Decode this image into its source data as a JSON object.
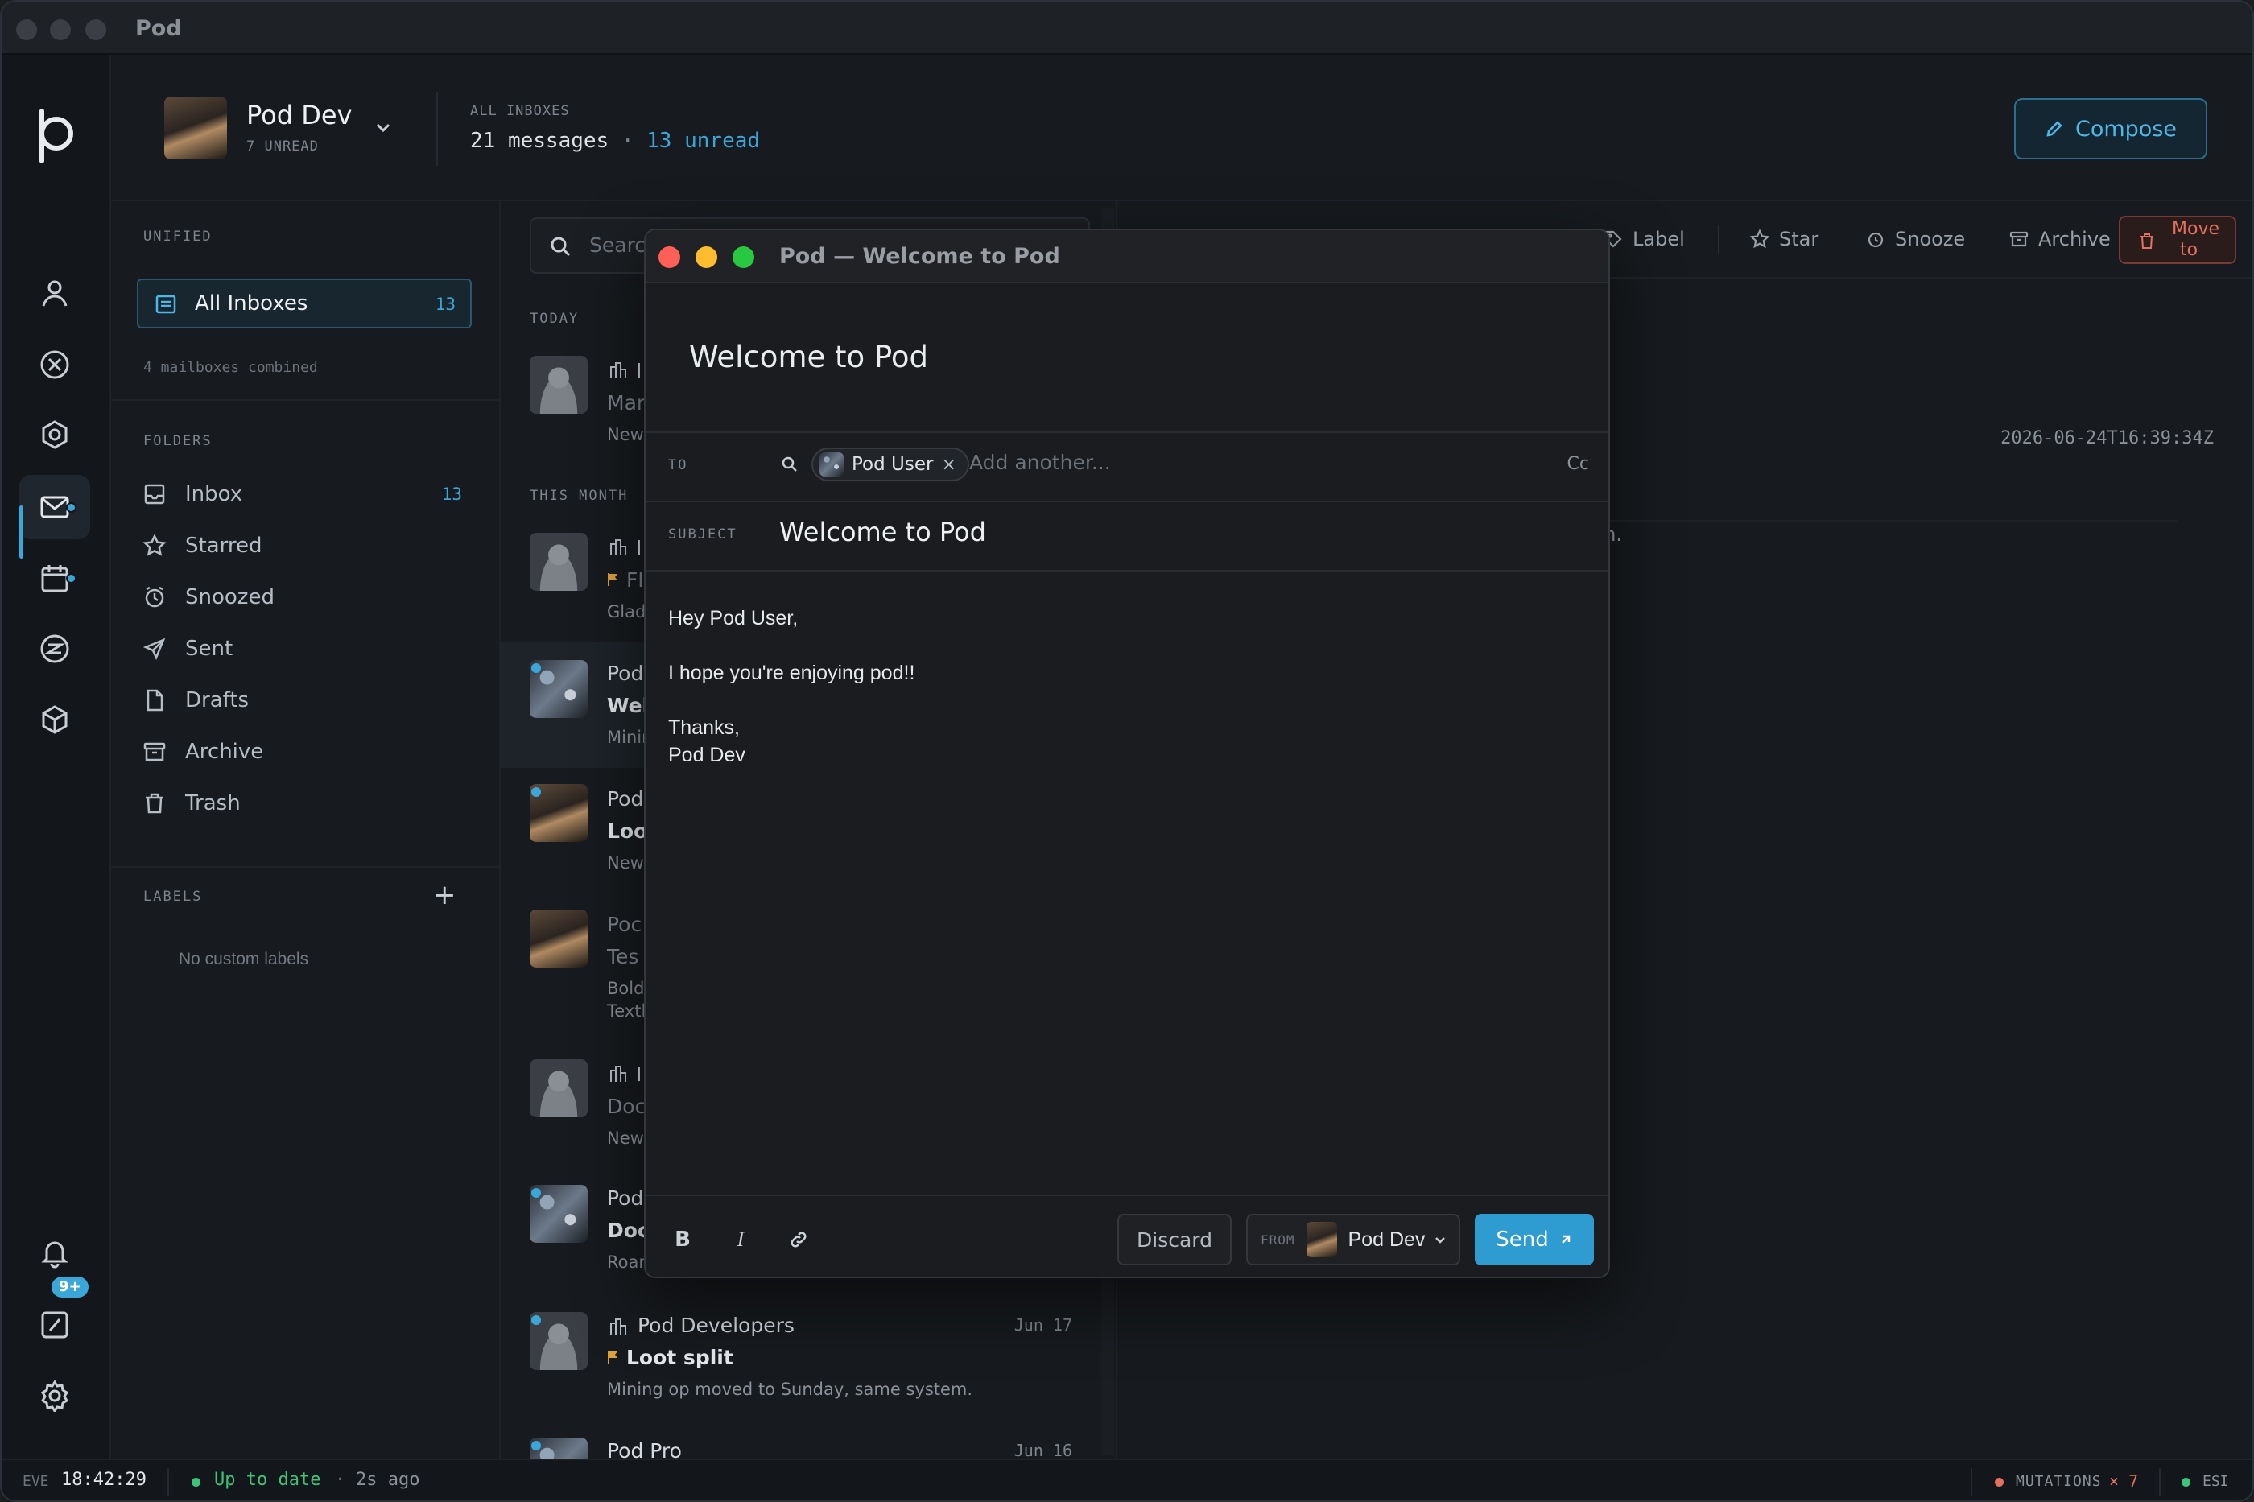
{
  "window": {
    "title": "Pod"
  },
  "account": {
    "name": "Pod Dev",
    "unread_label": "7 UNREAD"
  },
  "header": {
    "inbox_label": "ALL INBOXES",
    "messages": "21 messages",
    "separator": "·",
    "unread": "13 unread",
    "compose_label": "Compose"
  },
  "rail": {
    "items": [
      "profile-icon",
      "circle-x-icon",
      "hexagon-icon",
      "mail-icon",
      "calendar-icon",
      "z-circle-icon",
      "cube-icon"
    ],
    "notification_badge": "9+",
    "bottom_items": [
      "bell-icon",
      "terminal-icon",
      "gear-icon"
    ]
  },
  "sidebar": {
    "unified_label": "UNIFIED",
    "all_inboxes": {
      "label": "All Inboxes",
      "count": "13"
    },
    "combined_note": "4 mailboxes combined",
    "folders_label": "FOLDERS",
    "folders": [
      {
        "label": "Inbox",
        "count": "13",
        "icon": "inbox-icon"
      },
      {
        "label": "Starred",
        "count": "",
        "icon": "star-icon"
      },
      {
        "label": "Snoozed",
        "count": "",
        "icon": "clock-icon"
      },
      {
        "label": "Sent",
        "count": "",
        "icon": "send-icon"
      },
      {
        "label": "Drafts",
        "count": "",
        "icon": "file-icon"
      },
      {
        "label": "Archive",
        "count": "",
        "icon": "archive-icon"
      },
      {
        "label": "Trash",
        "count": "",
        "icon": "trash-icon"
      }
    ],
    "labels_label": "LABELS",
    "add_label": "+",
    "no_labels": "No custom labels"
  },
  "list": {
    "search_placeholder": "Search",
    "section_today": "TODAY",
    "section_month": "THIS MONTH",
    "rows": [
      {
        "sender": "I",
        "subject": "Mar",
        "preview": "New"
      },
      {
        "sender": "I",
        "subject": "Fl",
        "preview": "Glad"
      },
      {
        "sender": "Pod",
        "subject": "Wel",
        "preview": "Minir"
      },
      {
        "sender": "Pod",
        "subject": "Loo",
        "preview": "New"
      },
      {
        "sender": "Poc",
        "subject": "Tes",
        "preview": "Bold",
        "preview2": "Textl"
      },
      {
        "sender": "I",
        "subject": "Doc",
        "preview": "New"
      },
      {
        "sender": "Pod",
        "subject": "Doc",
        "preview": "Roan"
      },
      {
        "sender": "Pod Developers",
        "subject": "Loot split",
        "preview": "Mining op moved to Sunday, same system.",
        "date": "Jun 17"
      },
      {
        "sender": "Pod Pro",
        "date": "Jun 16"
      }
    ]
  },
  "reading": {
    "toolbar": {
      "label": "Label",
      "star": "Star",
      "snooze": "Snooze",
      "archive": "Archive",
      "move_line1": "Move",
      "move_line2": "to"
    },
    "timestamp": "2026-06-24T16:39:34Z",
    "fragment": "m."
  },
  "status": {
    "eve_label": "EVE",
    "clock": "18:42:29",
    "sync": "Up to date",
    "sep": "·",
    "ago": "2s ago",
    "mutations_label": "MUTATIONS",
    "mutations_count": "× 7",
    "esi": "ESI"
  },
  "compose": {
    "window_title": "Pod — Welcome to Pod",
    "heading": "Welcome to Pod",
    "to_label": "TO",
    "recipient": "Pod User",
    "chip_remove": "×",
    "add_placeholder": "Add another...",
    "cc_label": "Cc",
    "subject_label": "SUBJECT",
    "subject": "Welcome to Pod",
    "body": {
      "greeting": "Hey Pod User,",
      "line": "I hope you're enjoying pod!!",
      "signoff": "Thanks,",
      "signature": "Pod Dev"
    },
    "discard_label": "Discard",
    "from_label": "FROM",
    "from_name": "Pod Dev",
    "send_label": "Send",
    "bold_label": "B",
    "italic_label": "I"
  },
  "colors": {
    "accent": "#3ba7d9",
    "danger": "#e4715f",
    "flag": "#e0a13a",
    "ok": "#3ec37a"
  }
}
